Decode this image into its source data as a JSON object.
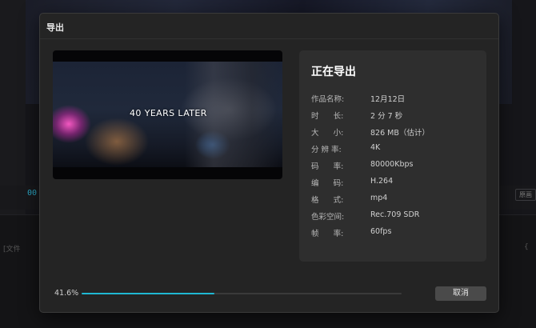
{
  "background": {
    "timecode": "00",
    "tag": "原画",
    "track_left": "[文件",
    "track_right": "{"
  },
  "dialog": {
    "title": "导出",
    "preview": {
      "caption": "40 YEARS LATER"
    },
    "info": {
      "heading": "正在导出",
      "rows": [
        {
          "label": "作品名称:",
          "value": "12月12日"
        },
        {
          "label": "时      长:",
          "value": "2 分 7 秒"
        },
        {
          "label": "大      小:",
          "value": "826 MB（估计）"
        },
        {
          "label": "分 辨 率:",
          "value": "4K"
        },
        {
          "label": "码      率:",
          "value": "80000Kbps"
        },
        {
          "label": "编      码:",
          "value": "H.264"
        },
        {
          "label": "格      式:",
          "value": "mp4"
        },
        {
          "label": "色彩空间:",
          "value": "Rec.709 SDR"
        },
        {
          "label": "帧      率:",
          "value": "60fps"
        }
      ]
    },
    "progress": {
      "percent_text": "41.6%",
      "fraction": 0.416
    },
    "cancel_label": "取消"
  },
  "colors": {
    "accent": "#1fb8d3",
    "dialog_bg": "#242424",
    "panel_bg": "#2e2e2e"
  }
}
